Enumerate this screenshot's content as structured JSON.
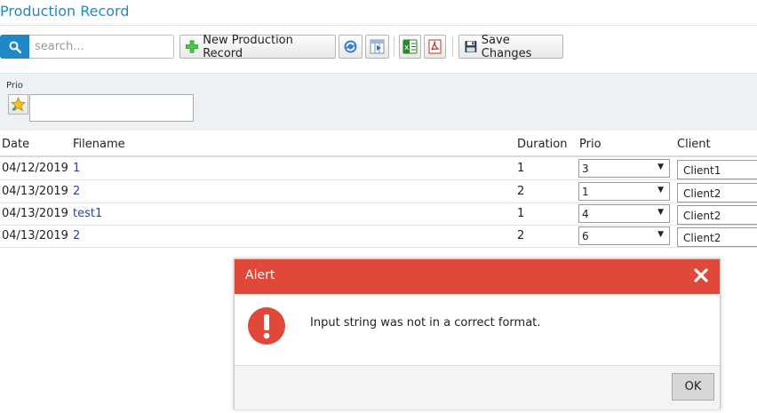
{
  "page": {
    "title": "Production Record"
  },
  "toolbar": {
    "search_placeholder": "search...",
    "search_value": "",
    "new_record_label": "New Production Record",
    "save_changes_label": "Save Changes"
  },
  "filter": {
    "label": "Prio",
    "value": ""
  },
  "table": {
    "headers": {
      "date": "Date",
      "filename": "Filename",
      "duration": "Duration",
      "prio": "Prio",
      "client": "Client"
    },
    "rows": [
      {
        "date": "04/12/2019",
        "filename": "1",
        "duration": "1",
        "prio": "3",
        "client": "Client1"
      },
      {
        "date": "04/13/2019",
        "filename": "2",
        "duration": "2",
        "prio": "1",
        "client": "Client2"
      },
      {
        "date": "04/13/2019",
        "filename": "test1",
        "duration": "1",
        "prio": "4",
        "client": "Client2"
      },
      {
        "date": "04/13/2019",
        "filename": "2",
        "duration": "2",
        "prio": "6",
        "client": "Client2"
      }
    ]
  },
  "alert": {
    "title": "Alert",
    "message": "Input string was not in a correct format.",
    "ok_label": "OK"
  },
  "colors": {
    "accent": "#1e88c9",
    "alert_header": "#e0493a",
    "link": "#2b3fb3"
  }
}
